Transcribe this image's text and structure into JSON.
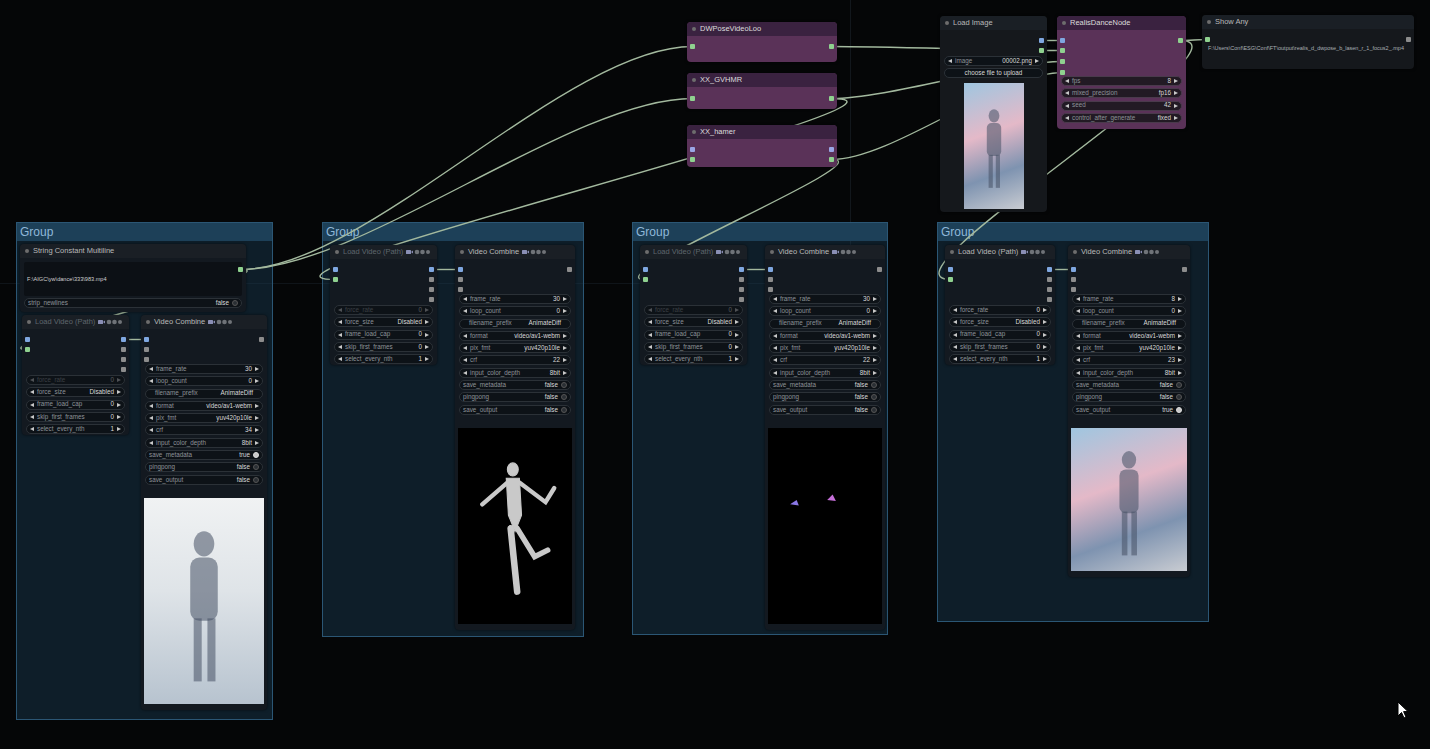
{
  "groups": [
    {
      "title": "Group"
    },
    {
      "title": "Group"
    },
    {
      "title": "Group"
    },
    {
      "title": "Group"
    }
  ],
  "nodes": [
    {
      "title": "DWPoseVideoLoo",
      "kind": "custom",
      "dim": false,
      "widgets": []
    },
    {
      "title": "XX_GVHMR",
      "kind": "custom",
      "dim": false,
      "widgets": []
    },
    {
      "title": "XX_hamer",
      "kind": "custom",
      "dim": false,
      "widgets": []
    },
    {
      "title": "Load Image",
      "kind": "plain",
      "dim": false,
      "preview": "photo-street",
      "widgets": [
        {
          "kind": "combo",
          "label": "image",
          "value": "00002.png"
        },
        {
          "kind": "button",
          "label": "choose file to upload"
        }
      ]
    },
    {
      "title": "RealisDanceNode",
      "kind": "custom",
      "dim": false,
      "widgets": [
        {
          "kind": "number",
          "label": "fps",
          "value": "8"
        },
        {
          "kind": "combo",
          "label": "mixed_precision",
          "value": "fp16"
        },
        {
          "kind": "number",
          "label": "seed",
          "value": "42"
        },
        {
          "kind": "combo",
          "label": "control_after_generate",
          "value": "fixed"
        }
      ]
    },
    {
      "title": "Show Any",
      "kind": "plain",
      "dim": false,
      "body": "F:\\Users\\Conf\\ESG\\Conf\\FT\\output\\realis_d_dwpose_b_lasen_r_1_focus2_.mp4",
      "widgets": []
    },
    {
      "title": "String Constant Multiline",
      "kind": "plain",
      "dim": false,
      "body": "F:\\AIGC\\yw\\dance\\333\\983.mp4",
      "widgets": [
        {
          "kind": "toggle",
          "label": "strip_newlines",
          "value": "false",
          "on": false
        }
      ]
    },
    {
      "title": "Load Video (Path)",
      "kind": "plain",
      "dim": true,
      "widgets": [
        {
          "kind": "number",
          "label": "force_rate",
          "value": "0",
          "faded": true
        },
        {
          "kind": "combo",
          "label": "force_size",
          "value": "Disabled"
        },
        {
          "kind": "number",
          "label": "frame_load_cap",
          "value": "0"
        },
        {
          "kind": "number",
          "label": "skip_first_frames",
          "value": "0"
        },
        {
          "kind": "number",
          "label": "select_every_nth",
          "value": "1"
        }
      ]
    },
    {
      "title": "Video Combine",
      "kind": "plain",
      "dim": false,
      "preview": "photo-indoor",
      "widgets": [
        {
          "kind": "number",
          "label": "frame_rate",
          "value": "30"
        },
        {
          "kind": "number",
          "label": "loop_count",
          "value": "0"
        },
        {
          "kind": "text",
          "label": "filename_prefix",
          "value": "AnimateDiff"
        },
        {
          "kind": "combo",
          "label": "format",
          "value": "video/av1-webm"
        },
        {
          "kind": "combo",
          "label": "pix_fmt",
          "value": "yuv420p10le"
        },
        {
          "kind": "number",
          "label": "crf",
          "value": "34"
        },
        {
          "kind": "combo",
          "label": "input_color_depth",
          "value": "8bit"
        },
        {
          "kind": "toggle",
          "label": "save_metadata",
          "value": "true",
          "on": true
        },
        {
          "kind": "toggle",
          "label": "pingpong",
          "value": "false",
          "on": false
        },
        {
          "kind": "toggle",
          "label": "save_output",
          "value": "false",
          "on": false
        }
      ]
    },
    {
      "title": "Load Video (Path)",
      "kind": "plain",
      "dim": true,
      "widgets": [
        {
          "kind": "number",
          "label": "force_rate",
          "value": "0",
          "faded": true
        },
        {
          "kind": "combo",
          "label": "force_size",
          "value": "Disabled"
        },
        {
          "kind": "number",
          "label": "frame_load_cap",
          "value": "0"
        },
        {
          "kind": "number",
          "label": "skip_first_frames",
          "value": "0"
        },
        {
          "kind": "number",
          "label": "select_every_nth",
          "value": "1"
        }
      ]
    },
    {
      "title": "Video Combine",
      "kind": "plain",
      "dim": false,
      "preview": "mesh",
      "widgets": [
        {
          "kind": "number",
          "label": "frame_rate",
          "value": "30"
        },
        {
          "kind": "number",
          "label": "loop_count",
          "value": "0"
        },
        {
          "kind": "text",
          "label": "filename_prefix",
          "value": "AnimateDiff"
        },
        {
          "kind": "combo",
          "label": "format",
          "value": "video/av1-webm"
        },
        {
          "kind": "combo",
          "label": "pix_fmt",
          "value": "yuv420p10le"
        },
        {
          "kind": "number",
          "label": "crf",
          "value": "22"
        },
        {
          "kind": "combo",
          "label": "input_color_depth",
          "value": "8bit"
        },
        {
          "kind": "toggle",
          "label": "save_metadata",
          "value": "false",
          "on": false
        },
        {
          "kind": "toggle",
          "label": "pingpong",
          "value": "false",
          "on": false
        },
        {
          "kind": "toggle",
          "label": "save_output",
          "value": "false",
          "on": false
        }
      ]
    },
    {
      "title": "Load Video (Path)",
      "kind": "plain",
      "dim": true,
      "widgets": [
        {
          "kind": "number",
          "label": "force_rate",
          "value": "0",
          "faded": true
        },
        {
          "kind": "combo",
          "label": "force_size",
          "value": "Disabled"
        },
        {
          "kind": "number",
          "label": "frame_load_cap",
          "value": "0"
        },
        {
          "kind": "number",
          "label": "skip_first_frames",
          "value": "0"
        },
        {
          "kind": "number",
          "label": "select_every_nth",
          "value": "1"
        }
      ]
    },
    {
      "title": "Video Combine",
      "kind": "plain",
      "dim": false,
      "preview": "hands",
      "widgets": [
        {
          "kind": "number",
          "label": "frame_rate",
          "value": "30"
        },
        {
          "kind": "number",
          "label": "loop_count",
          "value": "0"
        },
        {
          "kind": "text",
          "label": "filename_prefix",
          "value": "AnimateDiff"
        },
        {
          "kind": "combo",
          "label": "format",
          "value": "video/av1-webm"
        },
        {
          "kind": "combo",
          "label": "pix_fmt",
          "value": "yuv420p10le"
        },
        {
          "kind": "number",
          "label": "crf",
          "value": "22"
        },
        {
          "kind": "combo",
          "label": "input_color_depth",
          "value": "8bit"
        },
        {
          "kind": "toggle",
          "label": "save_metadata",
          "value": "false",
          "on": false
        },
        {
          "kind": "toggle",
          "label": "pingpong",
          "value": "false",
          "on": false
        },
        {
          "kind": "toggle",
          "label": "save_output",
          "value": "false",
          "on": false
        }
      ]
    },
    {
      "title": "Load Video (Path)",
      "kind": "plain",
      "dim": false,
      "widgets": [
        {
          "kind": "number",
          "label": "force_rate",
          "value": "0"
        },
        {
          "kind": "combo",
          "label": "force_size",
          "value": "Disabled"
        },
        {
          "kind": "number",
          "label": "frame_load_cap",
          "value": "0"
        },
        {
          "kind": "number",
          "label": "skip_first_frames",
          "value": "0"
        },
        {
          "kind": "number",
          "label": "select_every_nth",
          "value": "1"
        }
      ]
    },
    {
      "title": "Video Combine",
      "kind": "plain",
      "dim": false,
      "preview": "photo-street",
      "widgets": [
        {
          "kind": "number",
          "label": "frame_rate",
          "value": "8"
        },
        {
          "kind": "number",
          "label": "loop_count",
          "value": "0"
        },
        {
          "kind": "text",
          "label": "filename_prefix",
          "value": "AnimateDiff"
        },
        {
          "kind": "combo",
          "label": "format",
          "value": "video/av1-webm"
        },
        {
          "kind": "combo",
          "label": "pix_fmt",
          "value": "yuv420p10le"
        },
        {
          "kind": "number",
          "label": "crf",
          "value": "23"
        },
        {
          "kind": "combo",
          "label": "input_color_depth",
          "value": "8bit"
        },
        {
          "kind": "toggle",
          "label": "save_metadata",
          "value": "false",
          "on": false
        },
        {
          "kind": "toggle",
          "label": "pingpong",
          "value": "false",
          "on": false
        },
        {
          "kind": "toggle",
          "label": "save_output",
          "value": "true",
          "on": true
        }
      ]
    }
  ]
}
